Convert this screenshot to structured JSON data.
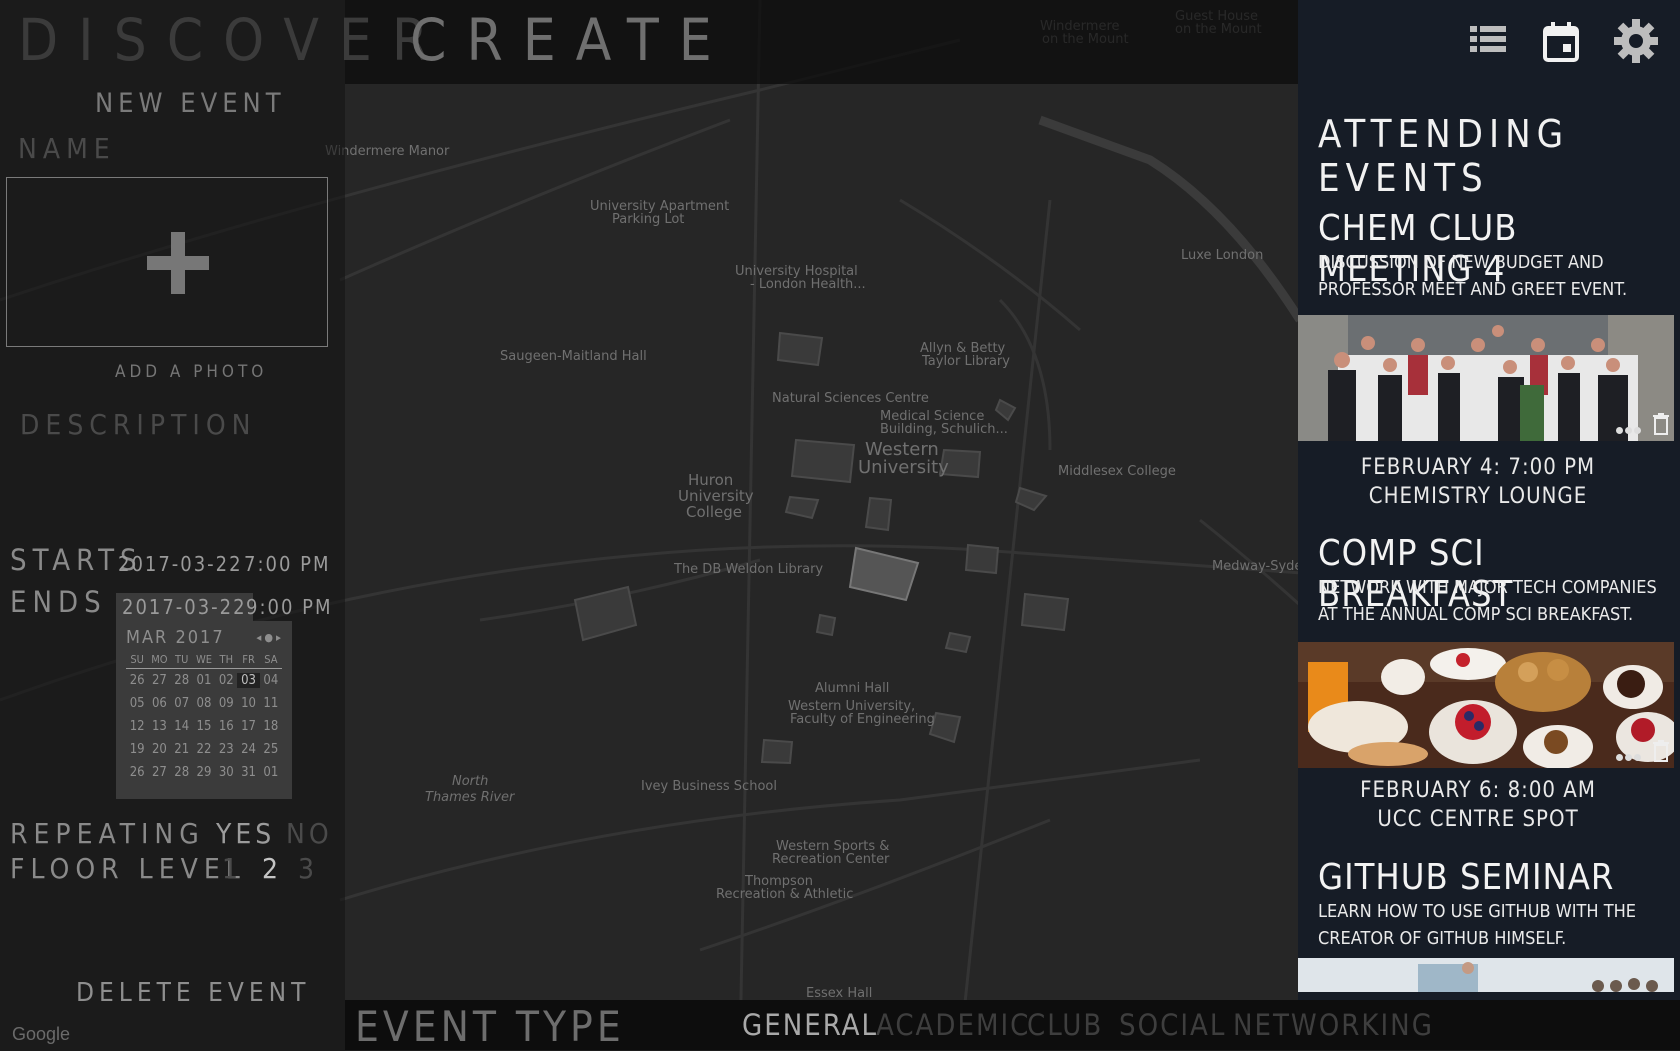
{
  "nav": {
    "discover": "DISCOVER",
    "create": "CREATE"
  },
  "create_panel": {
    "heading": "NEW EVENT",
    "name_label": "NAME",
    "add_photo": "ADD A PHOTO",
    "description_label": "DESCRIPTION",
    "starts_label": "STARTS",
    "start_date": "2017-03-22",
    "start_time": "7:00 PM",
    "ends_label": "ENDS",
    "end_date": "2017-03-22",
    "end_time": "9:00 PM",
    "calendar": {
      "month": "MAR 2017",
      "weekdays": [
        "SU",
        "MO",
        "TU",
        "WE",
        "TH",
        "FR",
        "SA"
      ],
      "weeks": [
        [
          "26",
          "27",
          "28",
          "01",
          "02",
          "03",
          "04"
        ],
        [
          "05",
          "06",
          "07",
          "08",
          "09",
          "10",
          "11"
        ],
        [
          "12",
          "13",
          "14",
          "15",
          "16",
          "17",
          "18"
        ],
        [
          "19",
          "20",
          "21",
          "22",
          "23",
          "24",
          "25"
        ],
        [
          "26",
          "27",
          "28",
          "29",
          "30",
          "31",
          "01"
        ]
      ],
      "selected": "03"
    },
    "repeating_label": "REPEATING",
    "repeating_yes": "YES",
    "repeating_no": "NO",
    "floor_label": "FLOOR LEVEL",
    "floor_options": [
      "1",
      "2",
      "3"
    ],
    "floor_selected": "2",
    "delete": "DELETE EVENT"
  },
  "map_attribution": "Google",
  "event_type": {
    "label": "EVENT TYPE",
    "options": [
      "GENERAL",
      "ACADEMIC",
      "CLUB",
      "SOCIAL",
      "NETWORKING"
    ],
    "active": "GENERAL"
  },
  "sidebar": {
    "title": "ATTENDING EVENTS",
    "icons": [
      "list-icon",
      "calendar-icon",
      "gear-icon"
    ],
    "events": [
      {
        "title": "CHEM CLUB MEETING 4",
        "description": "DISCUSSION OF NEW BUDGET AND PROFESSOR MEET AND GREET EVENT.",
        "date_time": "FEBRUARY 4: 7:00 PM",
        "location": "CHEMISTRY LOUNGE"
      },
      {
        "title": "COMP SCI BREAKFAST",
        "description": "NETWORK WITH MAJOR TECH COMPANIES AT THE ANNUAL COMP SCI BREAKFAST.",
        "date_time": "FEBRUARY 6: 8:00 AM",
        "location": "UCC CENTRE SPOT"
      },
      {
        "title": "GITHUB SEMINAR",
        "description": "LEARN HOW TO USE GITHUB WITH THE CREATOR OF GITHUB HIMSELF."
      }
    ]
  },
  "colors": {
    "accent_text": "#f1f1f1",
    "sidebar_bg": "#161c26",
    "map_bg": "#262626"
  }
}
